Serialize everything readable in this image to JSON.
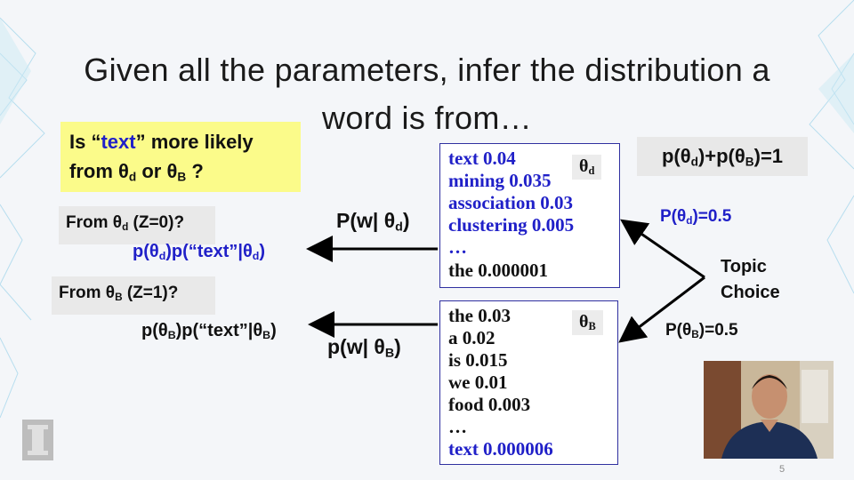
{
  "slide": {
    "title_line1": "Given all the parameters, infer the distribution a",
    "title_line2": "word is from…",
    "question": {
      "prefix": "Is “",
      "word": "text",
      "suffix": "” more likely",
      "line2_prefix": "from θ",
      "sub_d": "d",
      "or": " or θ",
      "sub_b": "B",
      "end": " ?"
    },
    "from_d": {
      "prefix": "From θ",
      "sub": "d",
      "suffix": " (Z=0)?"
    },
    "from_b": {
      "prefix": "From θ",
      "sub": "B",
      "suffix": " (Z=1)?"
    },
    "formula_d": {
      "a": "p(θ",
      "sub1": "d",
      "b": ")p(“text”|θ",
      "sub2": "d",
      "c": ")"
    },
    "formula_b": {
      "a": "p(θ",
      "sub1": "B",
      "b": ")p(“text”|θ",
      "sub2": "B",
      "c": ")"
    },
    "arrow_label_d": {
      "a": "P(w| θ",
      "sub": "d",
      "b": ")"
    },
    "arrow_label_b": {
      "a": "p(w| θ",
      "sub": "B",
      "b": ")"
    },
    "theta_d_box": {
      "tag": "θ",
      "tag_sub": "d",
      "rows": [
        "text  0.04",
        "mining 0.035",
        "association 0.03",
        "clustering 0.005",
        "…",
        "the 0.000001"
      ]
    },
    "theta_b_box": {
      "tag": "θ",
      "tag_sub": "B",
      "rows": [
        "the 0.03",
        "a 0.02",
        "is 0.015",
        "we 0.01",
        "food 0.003",
        "…",
        "text  0.000006"
      ]
    },
    "prob_sum": {
      "a": "p(θ",
      "s1": "d",
      "b": ")+p(θ",
      "s2": "B",
      "c": ")=1"
    },
    "p_theta_d": {
      "a": "P(θ",
      "sub": "d",
      "b": ")=0.5"
    },
    "p_theta_b": {
      "a": "P(θ",
      "sub": "B",
      "b": ")=0.5"
    },
    "topic_choice": [
      "Topic",
      "Choice"
    ],
    "page_number": "5"
  },
  "colors": {
    "accent_blue": "#2020c8",
    "highlight_yellow": "#fbfb8a",
    "box_border": "#3030a0"
  }
}
